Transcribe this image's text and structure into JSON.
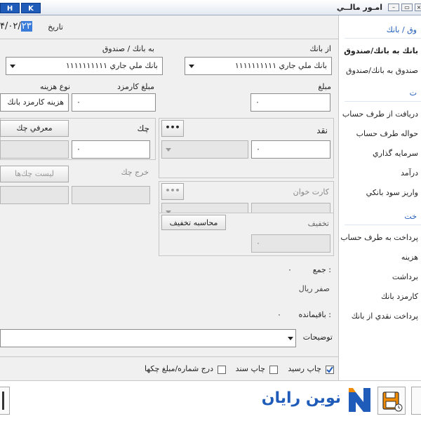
{
  "titlebar": {
    "key_h": "H",
    "key_k": "K",
    "title": "امـور مالــي"
  },
  "date": {
    "label": "تاريخ",
    "year_suffix": "۴/۰۲/",
    "day": "۲۳"
  },
  "to_bank": {
    "label": "به بانك / صندوق",
    "value": "بانك ملي جاري ١١١١١١١١١١"
  },
  "from_bank": {
    "label": "از بانك",
    "value": "بانك ملي جاري ١١١١١١١١١١"
  },
  "fee_type": {
    "label": "نوع هزينه",
    "value": "هزينه كارمزد بانك"
  },
  "fee_amount": {
    "label": "مبلغ كارمزد",
    "value": "۰"
  },
  "amount": {
    "label": "مبلغ",
    "value": "۰"
  },
  "check": {
    "label": "چك",
    "introduce_btn": "معرفي چك",
    "value": "۰",
    "out_label": "خرج چك",
    "list_btn": "ليست چك‌ها",
    "out_value": ""
  },
  "cash": {
    "label": "نقد",
    "more_btn": "•••",
    "value": "۰"
  },
  "card": {
    "label": "كارت خوان",
    "more_btn": "•••",
    "value": ""
  },
  "discount": {
    "label": "تخفيف",
    "calc_btn": "محاسبه تخفيف",
    "value": "۰"
  },
  "summary": {
    "total_label": "جمع :",
    "total_value": "۰",
    "total_words": "صفر ريال",
    "remain_label": "باقيمانده :",
    "remain_value": "۰"
  },
  "notes": {
    "label": "توضيحات"
  },
  "options": {
    "print_receipt": "چاپ رسيد",
    "print_voucher": "چاپ سند",
    "insert_check_numbers": "درج شماره/مبلغ چكها"
  },
  "sidebar": {
    "header1": "وق / بانك",
    "items1": [
      "بانك به بانك/صندوق",
      "صندوق به بانك/صندوق"
    ],
    "header2": "ت",
    "items2": [
      "دريافت از طرف حساب",
      "حواله طرف حساب",
      "سرمايه گذاري",
      "درآمد",
      "واريز سود بانكي"
    ],
    "header3": "خت",
    "items3": [
      "پرداخت به طرف حساب",
      "هزينه",
      "برداشت",
      "كارمزد بانك",
      "پرداخت نقدي از بانك"
    ]
  },
  "logo": {
    "text": "نوين رايان"
  },
  "colors": {
    "accent": "#1f5bb8",
    "logo_orange": "#f08a00"
  }
}
